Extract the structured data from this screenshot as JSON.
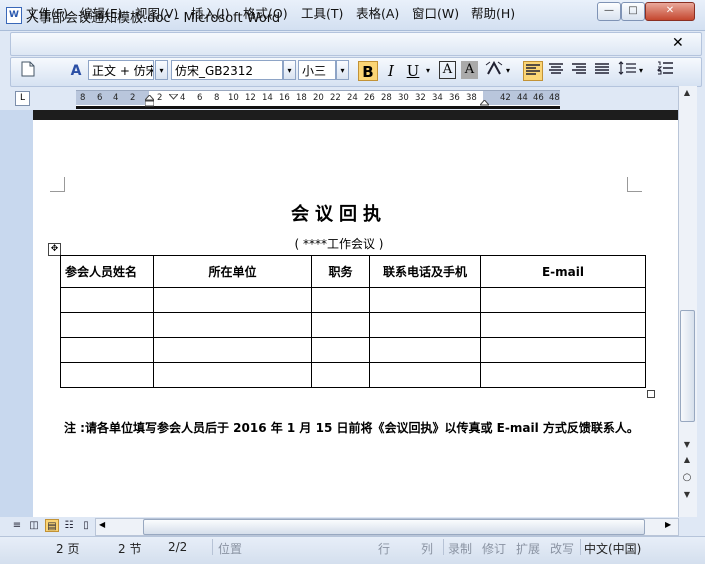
{
  "window": {
    "title": "人事部会议通知模板.doc - Microsoft Word",
    "icon_glyph": "W",
    "min_glyph": "—",
    "max_glyph": "□",
    "close_glyph": "✕"
  },
  "menu": {
    "items": [
      "文件(F)",
      "编辑(E)",
      "视图(V)",
      "插入(I)",
      "格式(O)",
      "工具(T)",
      "表格(A)",
      "窗口(W)",
      "帮助(H)"
    ],
    "close_glyph": "✕"
  },
  "toolbar": {
    "style_value": "正文 + 仿宋",
    "font_value": "仿宋_GB2312",
    "size_value": "小三",
    "bold": "B",
    "italic": "I",
    "underline": "U",
    "char_border": "A",
    "char_shading": "A",
    "dropdown_glyph": "▾"
  },
  "ruler": {
    "tab_glyph": "L",
    "ticks": [
      "8",
      "6",
      "4",
      "2",
      "2",
      "4",
      "6",
      "8",
      "10",
      "12",
      "14",
      "16",
      "18",
      "20",
      "22",
      "24",
      "26",
      "28",
      "30",
      "32",
      "34",
      "36",
      "38",
      "42",
      "44",
      "46",
      "48"
    ]
  },
  "document": {
    "title": "会议回执",
    "subtitle": "( ****工作会议 )",
    "table_headers": [
      "参会人员姓名",
      "所在单位",
      "职务",
      "联系电话及手机",
      "E-mail"
    ],
    "empty_rows": 4,
    "note": "注 :请各单位填写参会人员后于 2016 年 1 月 15 日前将《会议回执》以传真或 E-mail 方式反馈联系人。"
  },
  "status": {
    "page": "2 页",
    "section": "2 节",
    "page_of": "2/2",
    "position": "位置",
    "line": "行",
    "column": "列",
    "record": "录制",
    "revise": "修订",
    "extend": "扩展",
    "overwrite": "改写",
    "language": "中文(中国)"
  },
  "icons": {
    "new_doc": "new-document-icon",
    "styles": "styles-pane-icon",
    "highlight": "highlight-icon",
    "align_left": "align-left-icon",
    "align_center": "align-center-icon",
    "align_right": "align-right-icon",
    "justify": "justify-icon",
    "line_spacing": "line-spacing-icon",
    "numbering": "numbering-icon"
  }
}
